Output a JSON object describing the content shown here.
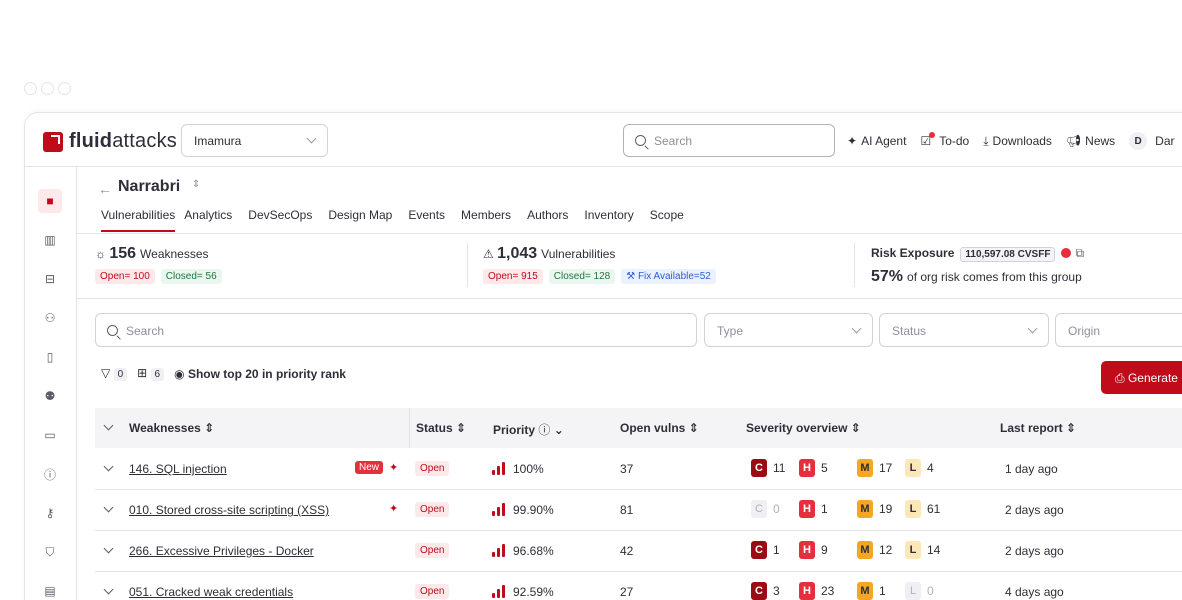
{
  "brand": {
    "name_bold": "fluid",
    "name_rest": "attacks"
  },
  "org_select": {
    "value": "Imamura"
  },
  "top_search": {
    "placeholder": "Search"
  },
  "topnav": {
    "ai_agent": "AI Agent",
    "todo": "To-do",
    "downloads": "Downloads",
    "news": "News",
    "avatar_initial": "D",
    "user_name": "Dar"
  },
  "project": {
    "name": "Narrabri",
    "tabs": [
      "Vulnerabilities",
      "Analytics",
      "DevSecOps",
      "Design Map",
      "Events",
      "Members",
      "Authors",
      "Inventory",
      "Scope"
    ],
    "active_tab": "Vulnerabilities"
  },
  "summary": {
    "weaknesses": {
      "count": "156",
      "label": "Weaknesses",
      "open": "Open= 100",
      "closed": "Closed= 56"
    },
    "vulnerabilities": {
      "count": "1,043",
      "label": "Vulnerabilities",
      "open": "Open= 915",
      "closed": "Closed= 128",
      "fix": "Fix Available=52"
    },
    "risk": {
      "title": "Risk Exposure",
      "cvssf": "110,597.08 CVSFF",
      "percent": "57%",
      "text": "of org risk comes from this group"
    }
  },
  "filters": {
    "search_placeholder": "Search",
    "type_placeholder": "Type",
    "status_placeholder": "Status",
    "origin_placeholder": "Origin",
    "filter_count": "0",
    "columns_count": "6",
    "show_top": "Show top 20 in priority rank",
    "generate": "Generate r"
  },
  "table": {
    "headers": {
      "weaknesses": "Weaknesses",
      "status": "Status",
      "priority": "Priority",
      "open_vulns": "Open vulns",
      "severity": "Severity overview",
      "last_report": "Last report"
    },
    "rows": [
      {
        "name": "146. SQL injection",
        "new": "New",
        "ai": true,
        "status": "Open",
        "priority": "100%",
        "open_vulns": "37",
        "sev": {
          "C": "11",
          "H": "5",
          "M": "17",
          "L": "4"
        },
        "last_report": "1 day ago"
      },
      {
        "name": "010. Stored cross-site scripting (XSS)",
        "new": "",
        "ai": true,
        "status": "Open",
        "priority": "99.90%",
        "open_vulns": "81",
        "sev": {
          "C": "0",
          "H": "1",
          "M": "19",
          "L": "61"
        },
        "last_report": "2 days ago"
      },
      {
        "name": "266. Excessive Privileges - Docker",
        "new": "",
        "ai": false,
        "status": "Open",
        "priority": "96.68%",
        "open_vulns": "42",
        "sev": {
          "C": "1",
          "H": "9",
          "M": "12",
          "L": "14"
        },
        "last_report": "2 days ago"
      },
      {
        "name": "051. Cracked weak credentials",
        "new": "",
        "ai": false,
        "status": "Open",
        "priority": "92.59%",
        "open_vulns": "27",
        "sev": {
          "C": "3",
          "H": "23",
          "M": "1",
          "L": "0"
        },
        "last_report": "4 days ago"
      }
    ]
  },
  "icons": [
    "search-icon",
    "chevron-down-icon",
    "sparkle-icon",
    "todo-icon",
    "download-icon",
    "megaphone-icon",
    "bug-icon",
    "warning-icon",
    "wrench-icon",
    "external-link-icon",
    "filter-icon",
    "columns-icon",
    "eye-icon",
    "info-icon",
    "sort-icon"
  ],
  "colors": {
    "brand": "#bf0b1a",
    "critical": "#9a0b14",
    "high": "#e52f3c",
    "medium": "#f5a623",
    "low": "#fce7b8"
  }
}
